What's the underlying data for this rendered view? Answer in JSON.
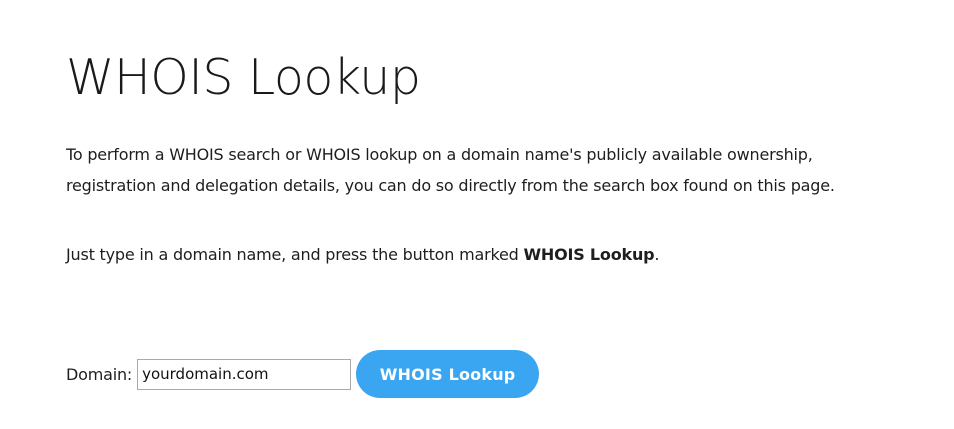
{
  "page": {
    "title": "WHOIS Lookup",
    "intro": "To perform a WHOIS search or WHOIS lookup on a domain name's publicly available ownership, registration and delegation details, you can do so directly from the search box found on this page.",
    "instruction_prefix": "Just type in a domain name, and press the button marked ",
    "instruction_button_name": "WHOIS Lookup",
    "instruction_suffix": "."
  },
  "form": {
    "label": "Domain:",
    "input_value": "yourdomain.com",
    "button_label": "WHOIS Lookup"
  },
  "colors": {
    "button_background": "#3aa5f1",
    "button_text": "#ffffff",
    "text": "#1e1e1e"
  }
}
